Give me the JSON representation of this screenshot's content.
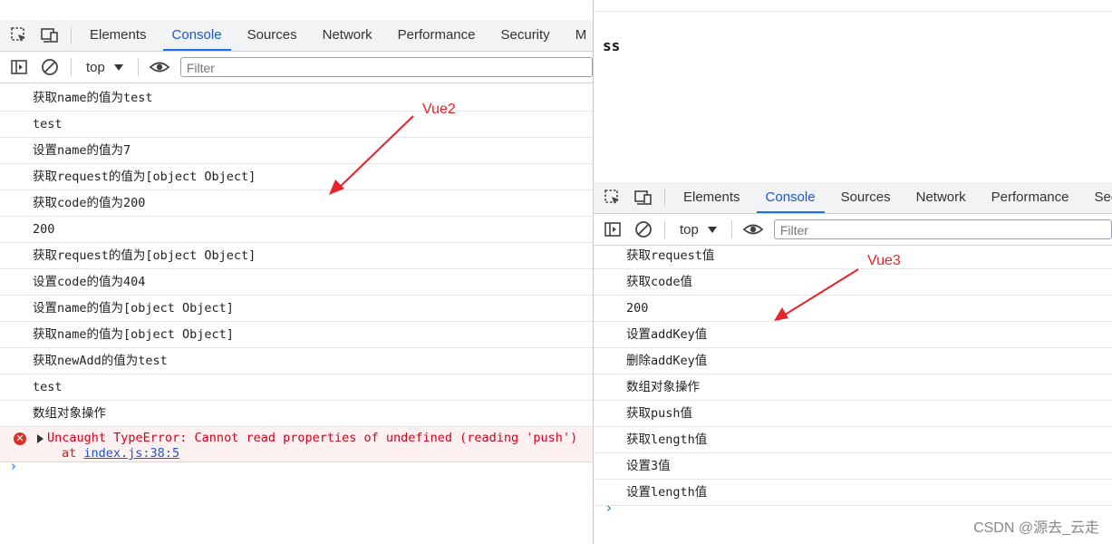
{
  "tabs": [
    "Elements",
    "Console",
    "Sources",
    "Network",
    "Performance",
    "Security",
    "M"
  ],
  "tabs_right": [
    "Elements",
    "Console",
    "Sources",
    "Network",
    "Performance",
    "Secu"
  ],
  "active_tab": "Console",
  "context": "top",
  "filter_placeholder": "Filter",
  "left_logs": [
    "获取name的值为test",
    "test",
    "设置name的值为7",
    "获取request的值为[object Object]",
    "获取code的值为200",
    "200",
    "获取request的值为[object Object]",
    "设置code的值为404",
    "设置name的值为[object Object]",
    "获取name的值为[object Object]",
    "获取newAdd的值为test",
    "test",
    "数组对象操作"
  ],
  "error": {
    "message": "Uncaught TypeError: Cannot read properties of undefined (reading 'push')",
    "stack_prefix": "at",
    "stack_link": "index.js:38:5"
  },
  "prompt": "›",
  "right_page_text": "ss",
  "right_logs": [
    "获取request值",
    "获取code值",
    "200",
    "设置addKey值",
    "删除addKey值",
    "数组对象操作",
    "获取push值",
    "获取length值",
    "设置3值",
    "设置length值"
  ],
  "annotations": {
    "left": "Vue2",
    "right": "Vue3"
  },
  "watermark": "CSDN @源去_云走",
  "colors": {
    "accent": "#1a73e8",
    "annotation": "#e8232a",
    "error_bg": "#fdf0f0"
  },
  "icons": [
    "inspect-icon",
    "device-toggle-icon",
    "sidebar-toggle-icon",
    "clear-console-icon",
    "eye-icon",
    "error-icon"
  ]
}
